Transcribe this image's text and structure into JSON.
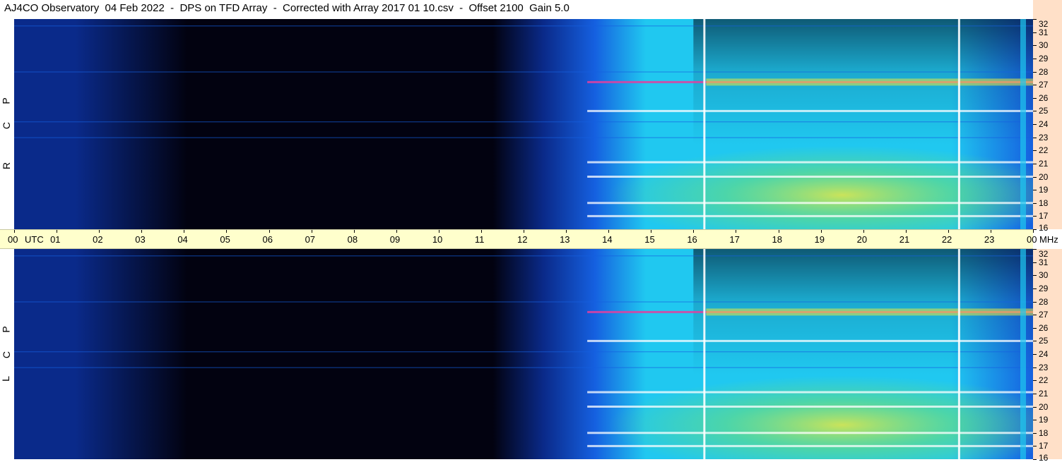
{
  "title": "AJ4CO Observatory  04 Feb 2022  -  DPS on TFD Array  -  Corrected with Array 2017 01 10.csv  -  Offset 2100  Gain 5.0",
  "side_labels": {
    "rcp": [
      "R",
      "C",
      "P"
    ],
    "lcp": [
      "L",
      "C",
      "P"
    ]
  },
  "colors": {
    "background_dark": "#020210",
    "deep_blue": "#0a2a8a",
    "mid_blue": "#1560e0",
    "cyan": "#20c8f0",
    "green": "#70e070",
    "yellow": "#e8e840",
    "magenta": "#e040a0",
    "time_strip": "#ffffcc",
    "freq_strip": "#ffe0c8"
  },
  "chart_data": {
    "type": "heatmap",
    "title": "AJ4CO Observatory  04 Feb 2022  -  DPS on TFD Array  -  Corrected with Array 2017 01 10.csv  -  Offset 2100  Gain 5.0",
    "x_axis": {
      "label_start": "00",
      "unit_label": "UTC",
      "ticks": [
        "00",
        "01",
        "02",
        "03",
        "04",
        "05",
        "06",
        "07",
        "08",
        "09",
        "10",
        "11",
        "12",
        "13",
        "14",
        "15",
        "16",
        "17",
        "18",
        "19",
        "20",
        "21",
        "22",
        "23",
        "00"
      ],
      "end_unit": "MHz",
      "range_hours": [
        0,
        24
      ]
    },
    "y_axis": {
      "unit": "MHz",
      "ticks": [
        "32",
        "31",
        "30",
        "29",
        "28",
        "27",
        "26",
        "25",
        "24",
        "23",
        "22",
        "21",
        "20",
        "19",
        "18",
        "17",
        "16"
      ],
      "range": [
        16,
        32
      ]
    },
    "panels": [
      {
        "name": "RCP",
        "polarization": "R C P"
      },
      {
        "name": "LCP",
        "polarization": "L C P"
      }
    ],
    "colormap": [
      "#020210",
      "#0a2a8a",
      "#1560e0",
      "#20c8f0",
      "#70e070",
      "#e8e840",
      "#e040a0",
      "#ffffff"
    ],
    "bright_bands_mhz": [
      27.2,
      25.0,
      21.1,
      20.0,
      18.0,
      17.0
    ],
    "vertical_markers_utc": [
      16.25,
      22.25
    ]
  }
}
